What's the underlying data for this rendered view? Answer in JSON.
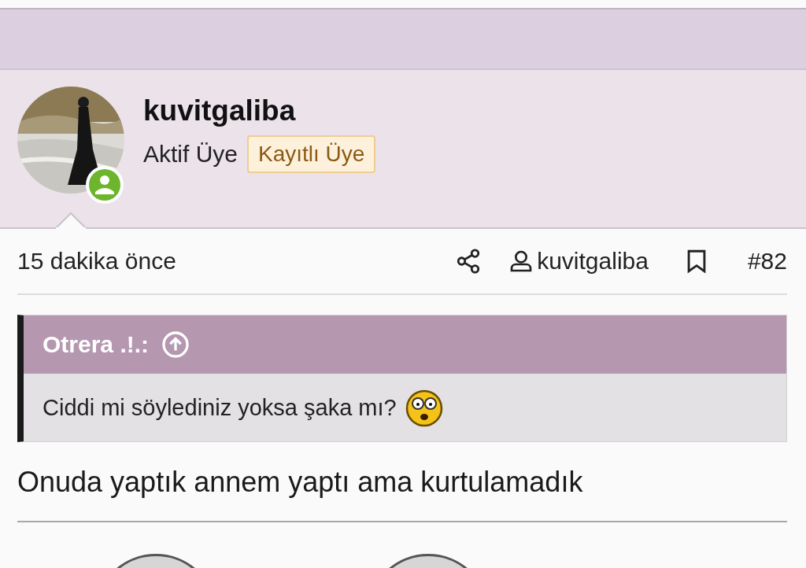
{
  "author": {
    "name": "kuvitgaliba",
    "title": "Aktif Üye",
    "badge": "Kayıtlı Üye",
    "online": true
  },
  "meta": {
    "time": "15 dakika önce",
    "user": "kuvitgaliba",
    "number": "#82",
    "bookmarked": false
  },
  "quote": {
    "author": "Otrera .!.:",
    "text": "Ciddi mi söylediniz yoksa şaka mı?"
  },
  "message": "Onuda yaptık annem yaptı ama kurtulamadık"
}
